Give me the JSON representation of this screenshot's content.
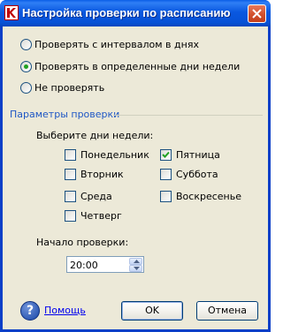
{
  "window": {
    "title": "Настройка проверки по расписанию",
    "app_icon": "kaspersky-icon",
    "close_icon": "close-icon"
  },
  "schedule_options": [
    {
      "label": "Проверять с интервалом в днях",
      "selected": false
    },
    {
      "label": "Проверять в определенные дни недели",
      "selected": true
    },
    {
      "label": "Не проверять",
      "selected": false
    }
  ],
  "params": {
    "group_title": "Параметры проверки",
    "days_label": "Выберите дни недели:",
    "days": [
      {
        "label": "Понедельник",
        "checked": false
      },
      {
        "label": "Вторник",
        "checked": false
      },
      {
        "label": "Среда",
        "checked": false
      },
      {
        "label": "Четверг",
        "checked": false
      },
      {
        "label": "Пятница",
        "checked": true
      },
      {
        "label": "Суббота",
        "checked": false
      },
      {
        "label": "Воскресенье",
        "checked": false
      }
    ],
    "start_label": "Начало проверки:",
    "start_time": "20:00"
  },
  "footer": {
    "help_icon": "help-icon",
    "help_glyph": "?",
    "help_link": "Помощь",
    "ok_label": "OK",
    "cancel_label": "Отмена"
  },
  "colors": {
    "titlebar": "#0a58e0",
    "client_bg": "#ece9d8",
    "group_title": "#1f57c5",
    "close_button": "#d2502c",
    "check_mark": "#21a121"
  }
}
